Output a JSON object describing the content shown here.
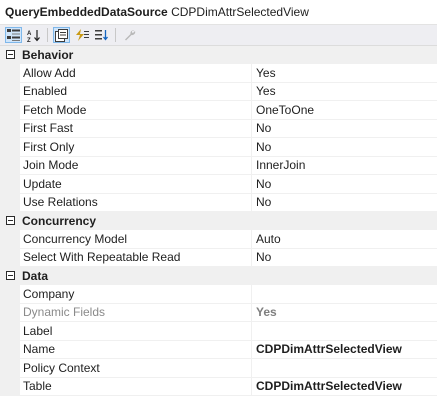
{
  "header": {
    "object_type": "QueryEmbeddedDataSource",
    "object_name": "CDPDimAttrSelectedView"
  },
  "toolbar": {
    "buttons": [
      {
        "icon": "categorized-icon",
        "active": true
      },
      {
        "icon": "alphabetical-icon",
        "active": false
      },
      {
        "icon": "properties-icon",
        "active": true
      },
      {
        "icon": "events-icon",
        "active": false
      },
      {
        "icon": "sort-icon",
        "active": false
      },
      {
        "icon": "wrench-icon",
        "active": false
      }
    ]
  },
  "categories": [
    {
      "label": "Behavior",
      "properties": [
        {
          "name": "Allow Add",
          "value": "Yes"
        },
        {
          "name": "Enabled",
          "value": "Yes"
        },
        {
          "name": "Fetch Mode",
          "value": "OneToOne"
        },
        {
          "name": "First Fast",
          "value": "No"
        },
        {
          "name": "First Only",
          "value": "No"
        },
        {
          "name": "Join Mode",
          "value": "InnerJoin"
        },
        {
          "name": "Update",
          "value": "No"
        },
        {
          "name": "Use Relations",
          "value": "No"
        }
      ]
    },
    {
      "label": "Concurrency",
      "properties": [
        {
          "name": "Concurrency Model",
          "value": "Auto"
        },
        {
          "name": "Select With Repeatable Read",
          "value": "No"
        }
      ]
    },
    {
      "label": "Data",
      "properties": [
        {
          "name": "Company",
          "value": ""
        },
        {
          "name": "Dynamic Fields",
          "value": "Yes",
          "dim": true
        },
        {
          "name": "Label",
          "value": ""
        },
        {
          "name": "Name",
          "value": "CDPDimAttrSelectedView",
          "bold": true
        },
        {
          "name": "Policy Context",
          "value": ""
        },
        {
          "name": "Table",
          "value": "CDPDimAttrSelectedView",
          "bold": true
        }
      ]
    }
  ]
}
